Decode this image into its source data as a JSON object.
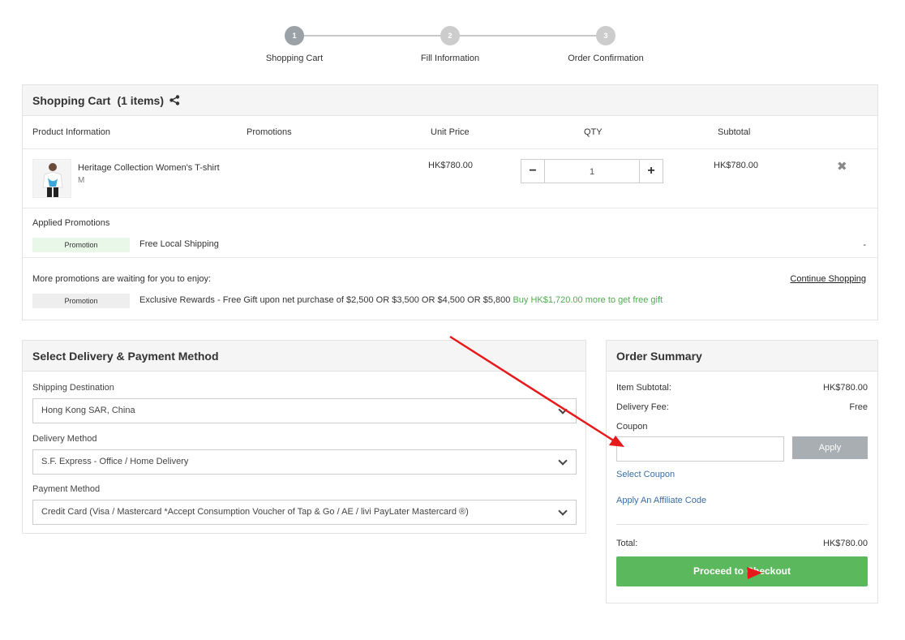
{
  "stepper": {
    "steps": [
      {
        "number": "1",
        "label": "Shopping Cart"
      },
      {
        "number": "2",
        "label": "Fill Information"
      },
      {
        "number": "3",
        "label": "Order Confirmation"
      }
    ]
  },
  "cart": {
    "title": "Shopping Cart",
    "count": "(1 items)",
    "columns": {
      "product": "Product Information",
      "promotions": "Promotions",
      "unit_price": "Unit Price",
      "qty": "QTY",
      "subtotal": "Subtotal"
    },
    "item": {
      "name": "Heritage Collection Women's T-shirt",
      "size": "M",
      "unit_price": "HK$780.00",
      "qty": "1",
      "subtotal": "HK$780.00",
      "minus": "−",
      "plus": "+",
      "remove": "✖"
    },
    "applied": {
      "title": "Applied Promotions",
      "badge": "Promotion",
      "text": "Free Local Shipping",
      "value": "-"
    },
    "more": {
      "title": "More promotions are waiting for you to enjoy:",
      "continue": "Continue Shopping",
      "badge": "Promotion",
      "text": "Exclusive Rewards - Free Gift upon net purchase of $2,500 OR $3,500 OR $4,500 OR $5,800",
      "highlight": "Buy HK$1,720.00 more to get free gift"
    }
  },
  "delivery": {
    "title": "Select Delivery & Payment Method",
    "shipping_label": "Shipping Destination",
    "shipping_value": "Hong Kong SAR, China",
    "method_label": "Delivery Method",
    "method_value": "S.F. Express - Office / Home Delivery",
    "payment_label": "Payment Method",
    "payment_value": "Credit Card (Visa / Mastercard *Accept Consumption Voucher of Tap & Go / AE / livi PayLater Mastercard ®)"
  },
  "summary": {
    "title": "Order Summary",
    "item_subtotal_label": "Item Subtotal:",
    "item_subtotal_value": "HK$780.00",
    "delivery_fee_label": "Delivery Fee:",
    "delivery_fee_value": "Free",
    "coupon_label": "Coupon",
    "apply_label": "Apply",
    "select_coupon": "Select Coupon",
    "affiliate": "Apply An Affiliate Code",
    "total_label": "Total:",
    "total_value": "HK$780.00",
    "checkout_label": "Proceed to Checkout"
  },
  "colors": {
    "checkout_green": "#5cb85c",
    "link_blue": "#3a6ea5",
    "promo_green": "#4cae4c",
    "annotation_red": "#e8191a"
  }
}
